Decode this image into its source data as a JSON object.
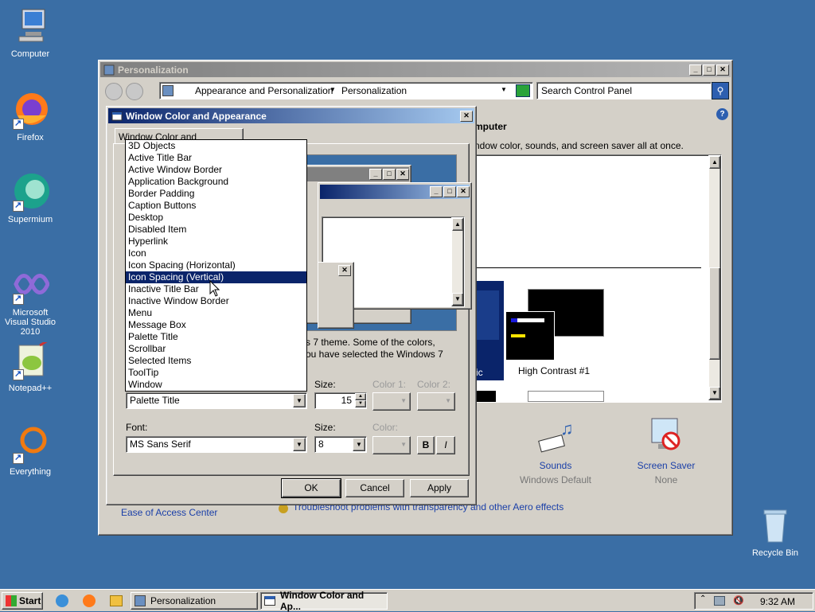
{
  "desktop": {
    "icons": [
      {
        "label": "Computer",
        "icon": "computer-icon"
      },
      {
        "label": "Firefox",
        "icon": "firefox-icon"
      },
      {
        "label": "Supermium",
        "icon": "supermium-icon"
      },
      {
        "label": "Microsoft Visual Studio 2010",
        "icon": "visual-studio-icon"
      },
      {
        "label": "Notepad++",
        "icon": "notepadpp-icon"
      },
      {
        "label": "Everything",
        "icon": "everything-icon"
      },
      {
        "label": "Recycle Bin",
        "icon": "recycle-bin-icon"
      }
    ]
  },
  "personalization": {
    "title": "Personalization",
    "breadcrumb": [
      "Appearance and Personalization",
      "Personalization"
    ],
    "search_placeholder": "Search Control Panel",
    "heading_partial": "mputer",
    "desc_partial": "ndow color, sounds, and screen saver all at once.",
    "theme_high_contrast": "High Contrast #1",
    "theme_partial_label": "ic",
    "sounds": {
      "label": "Sounds",
      "value": "Windows Default"
    },
    "screensaver": {
      "label": "Screen Saver",
      "value": "None"
    },
    "ease_link": "Ease of Access Center",
    "aero_link": "Troubleshoot problems with transparency and other Aero effects"
  },
  "dialog": {
    "title": "Window Color and Appearance",
    "tab": "Window Color and Appearance",
    "desc_line1": "s 7 theme.  Some of the colors,",
    "desc_line2": "ou have selected the Windows 7",
    "item_selected": "Palette Title",
    "size_label": "Size:",
    "size_value": "15",
    "color1_label": "Color 1:",
    "color2_label": "Color 2:",
    "font_label": "Font:",
    "font_value": "MS Sans Serif",
    "font_size_label": "Size:",
    "font_size_value": "8",
    "font_color_label": "Color:",
    "bold": "B",
    "italic": "I",
    "ok": "OK",
    "cancel": "Cancel",
    "apply": "Apply",
    "dropdown_items": [
      "3D Objects",
      "Active Title Bar",
      "Active Window Border",
      "Application Background",
      "Border Padding",
      "Caption Buttons",
      "Desktop",
      "Disabled Item",
      "Hyperlink",
      "Icon",
      "Icon Spacing (Horizontal)",
      "Icon Spacing (Vertical)",
      "Inactive Title Bar",
      "Inactive Window Border",
      "Menu",
      "Message Box",
      "Palette Title",
      "Scrollbar",
      "Selected Items",
      "ToolTip",
      "Window"
    ],
    "highlighted_index": 11
  },
  "taskbar": {
    "start": "Start",
    "tasks": [
      "Personalization",
      "Window Color and Ap..."
    ],
    "clock": "9:32 AM"
  },
  "colors": {
    "desktop": "#3a6ea5",
    "title_active": "#0a246a",
    "chrome": "#d4d0c8"
  }
}
